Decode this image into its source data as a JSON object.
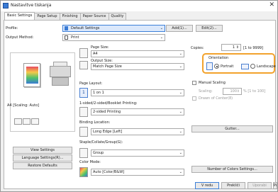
{
  "window": {
    "title": "Nastavitve tiskanja",
    "close": "✕"
  },
  "tabs": [
    "Basic Settings",
    "Page Setup",
    "Finishing",
    "Paper Source",
    "Quality"
  ],
  "profile": {
    "label": "Profile:",
    "value": "Default Settings",
    "add_label": "Add(1)...",
    "edit_label": "Edit(2)..."
  },
  "output_method": {
    "label": "Output Method:",
    "value": "Print"
  },
  "page_size": {
    "label": "Page Size:",
    "value": "A4"
  },
  "output_size": {
    "label": "Output Size:",
    "value": "Match Page Size"
  },
  "copies": {
    "label": "Copies:",
    "value": "1",
    "range": "[1 to 9999]"
  },
  "orientation": {
    "label": "Orientation",
    "portrait": "Portrait",
    "landscape": "Landscape",
    "selected": "portrait"
  },
  "page_layout": {
    "label": "Page Layout:",
    "value": "1 on 1"
  },
  "manual_scaling": {
    "label": "Manual Scaling",
    "scaling_label": "Scaling:",
    "scaling_value": "100",
    "scaling_range": "% [1 to 100]",
    "drawn_label": "Drawn of Center(8)"
  },
  "printing_mode": {
    "label": "1-sided/2-sided/Booklet Printing:",
    "value": "2-sided Printing"
  },
  "binding": {
    "label": "Binding Location:",
    "value": "Long Edge [Left]",
    "gutter_label": "Gutter..."
  },
  "staple": {
    "label": "Staple/Collate/Group(G):",
    "value": "Group"
  },
  "color_mode": {
    "label": "Color Mode:",
    "value": "Auto [Color/B&W]",
    "colors_button": "Number of Colors Settings..."
  },
  "preview": {
    "caption": "A4 [Scaling: Auto]"
  },
  "left_buttons": {
    "view_settings": "View Settings",
    "language_settings": "Language Settings(R)...",
    "restore_defaults": "Restore Defaults"
  },
  "footer": {
    "ok": "V redu",
    "cancel": "Prekliči",
    "apply": "Uporabi",
    "help": "Pomoč"
  }
}
